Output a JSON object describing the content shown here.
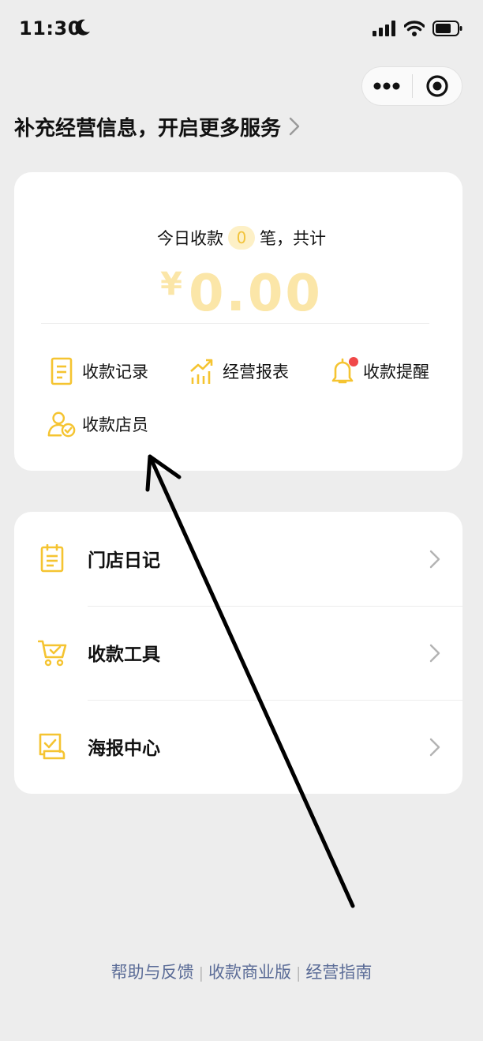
{
  "status_bar": {
    "time": "11:30"
  },
  "promo": {
    "text": "补充经营信息，开启更多服务"
  },
  "summary": {
    "prefix": "今日收款",
    "count": "0",
    "suffix": "笔，共计",
    "currency": "¥",
    "amount": "0.00"
  },
  "quick_actions": [
    {
      "label": "收款记录",
      "icon": "document-icon"
    },
    {
      "label": "经营报表",
      "icon": "chart-icon"
    },
    {
      "label": "收款提醒",
      "icon": "bell-icon"
    },
    {
      "label": "收款店员",
      "icon": "staff-icon"
    }
  ],
  "menu": [
    {
      "label": "门店日记",
      "icon": "clipboard-icon"
    },
    {
      "label": "收款工具",
      "icon": "cart-icon"
    },
    {
      "label": "海报中心",
      "icon": "poster-icon"
    }
  ],
  "footer": {
    "links": [
      "帮助与反馈",
      "收款商业版",
      "经营指南"
    ],
    "separator": "|"
  },
  "colors": {
    "accent": "#f5c431",
    "link": "#5b6c97",
    "badge": "#f04848"
  }
}
